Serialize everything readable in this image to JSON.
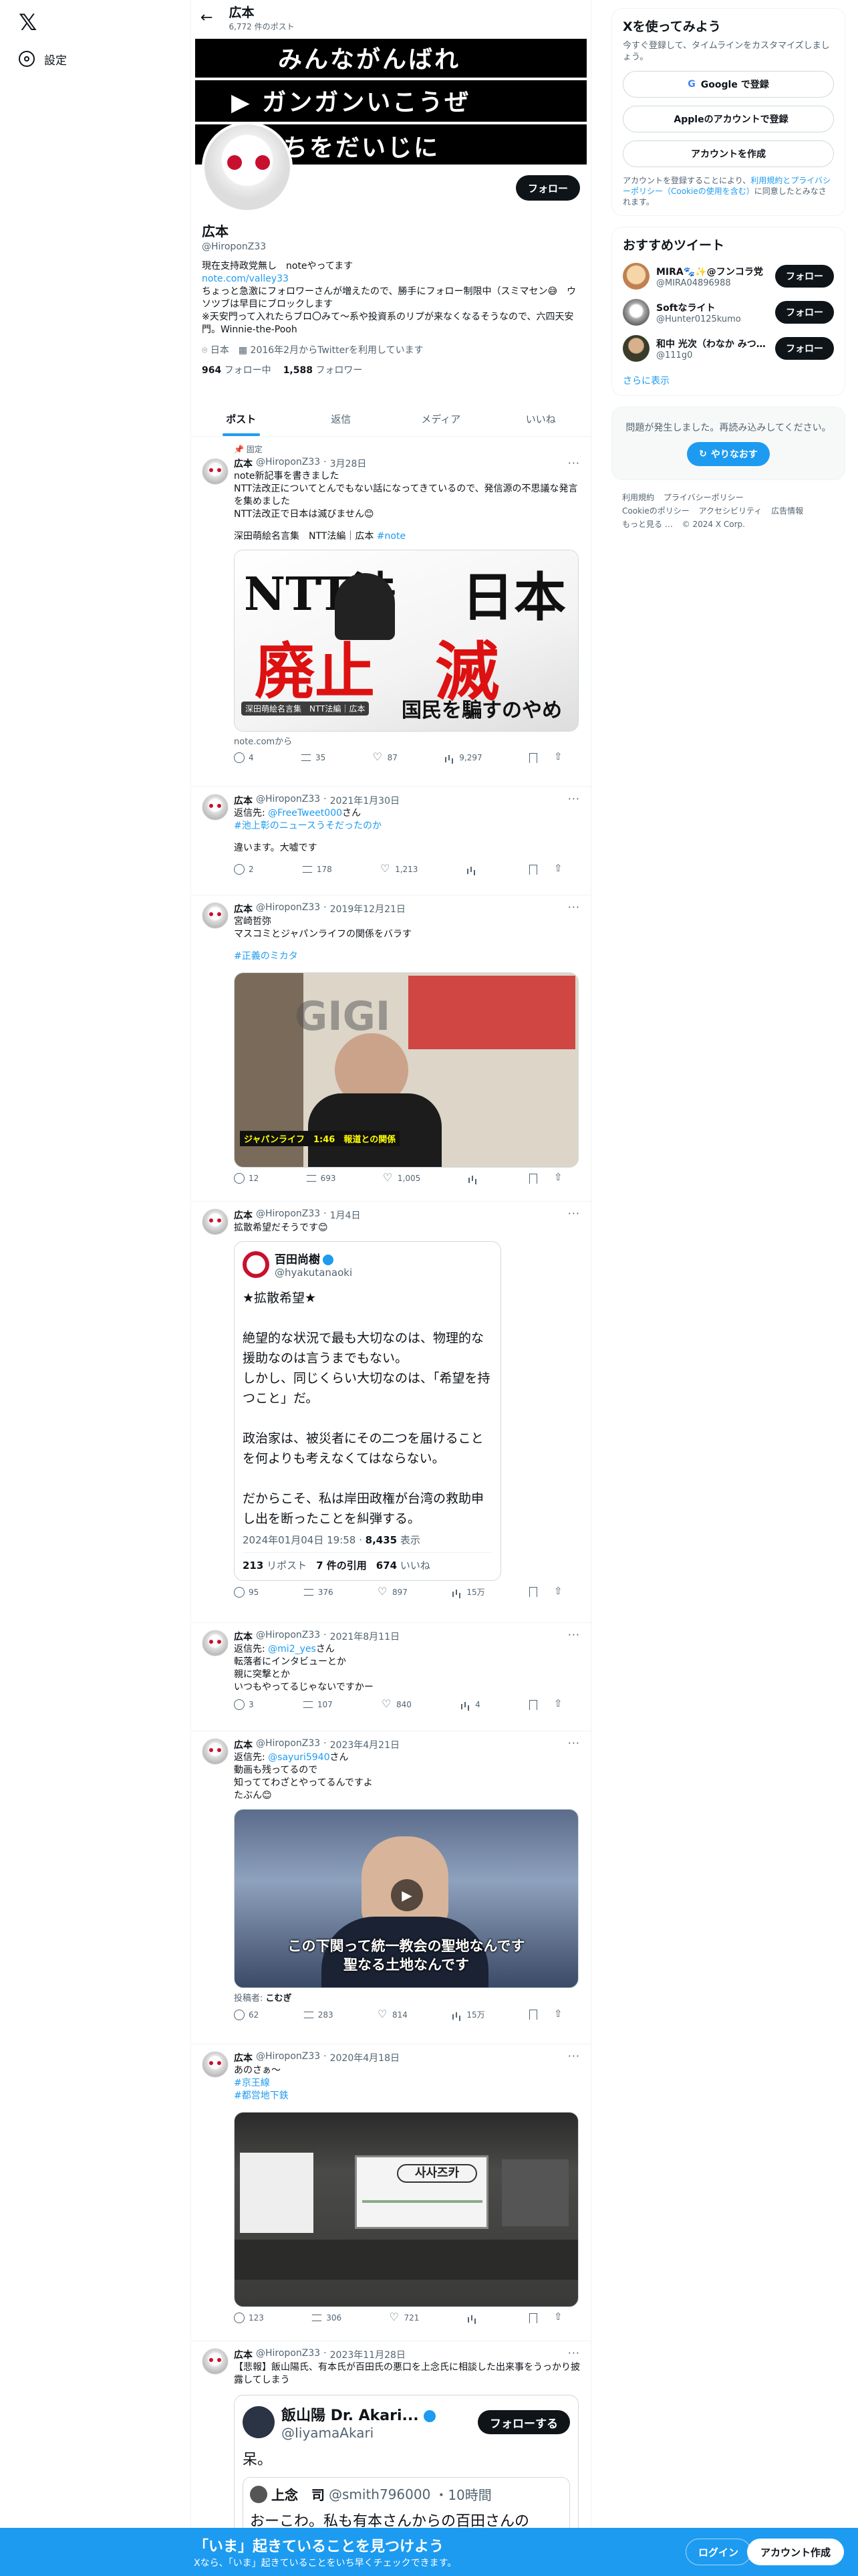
{
  "nav": {
    "settings_label": "設定",
    "logo_glyph": "𝕏"
  },
  "topbar": {
    "name": "広本",
    "post_count": "6,772 件のポスト"
  },
  "banner": {
    "line1": "みんながんばれ",
    "line2": "ガンガンいこうぜ",
    "line3": "いのちをだいじに"
  },
  "profile": {
    "follow_label": "フォロー",
    "name": "広本",
    "handle": "@HiroponZ33",
    "bio_1": "現在支持政党無し　noteやってます",
    "bio_link": "note.com/valley33",
    "bio_2": "ちょっと急激にフォロワーさんが増えたので、勝手にフォロー制限中（スミマセン😅　ウソツブは早目にブロックします\n※天安門って入れたらブロ〇みて〜系や投資系のリプが来なくなるそうなので、六四天安門。Winnie-the-Pooh",
    "location": "日本",
    "joined": "2016年2月からTwitterを利用しています",
    "following_count": "964",
    "following_label": "フォロー中",
    "followers_count": "1,588",
    "followers_label": "フォロワー"
  },
  "tabs": [
    "ポスト",
    "返信",
    "メディア",
    "いいね"
  ],
  "tweets": [
    {
      "pinned": "固定",
      "name": "広本",
      "handle": "@HiroponZ33",
      "date": "3月28日",
      "text": "note新記事を書きました\nNTT法改正についてとんでもない話になってきているので、発信源の不思議な発言を集めました\nNTT法改正で日本は滅びません😊",
      "text2": "深田萌絵名言集　NTT法編｜広本",
      "link": "#note",
      "media_caption": "深田萌絵名言集　NTT法編｜広本",
      "media_texts": {
        "a": "NTT法",
        "b": "廃止",
        "c": "日本",
        "d": "滅",
        "e": "国民を騙すのやめて!"
      },
      "card_source": "note.comから",
      "stats": {
        "reply": "4",
        "retweet": "35",
        "like": "87",
        "views": "9,297"
      }
    },
    {
      "name": "広本",
      "handle": "@HiroponZ33",
      "date": "2021年1月30日",
      "reply_to_label": "返信先:",
      "reply_to": "@FreeTweet000",
      "reply_to_suffix": "さん",
      "hashtag": "#池上彰のニュースうそだったのか",
      "text": "違います。大嘘です",
      "stats": {
        "reply": "2",
        "retweet": "178",
        "like": "1,213",
        "views": ""
      }
    },
    {
      "name": "広本",
      "handle": "@HiroponZ33",
      "date": "2019年12月21日",
      "text": "宮崎哲弥\nマスコミとジャパンライフの関係をバラす",
      "hashtag": "#正義のミカタ",
      "media_caption": "ジャパンライフ　1:46　報道との関係",
      "stats": {
        "reply": "12",
        "retweet": "693",
        "like": "1,005",
        "views": ""
      }
    },
    {
      "name": "広本",
      "handle": "@HiroponZ33",
      "date": "1月4日",
      "text": "拡散希望だそうです😊",
      "quote": {
        "name": "百田尚樹",
        "handle": "@hyakutanaoki",
        "text": "★拡散希望★\n\n絶望的な状況で最も大切なのは、物理的な援助なのは言うまでもない。\nしかし、同じくらい大切なのは、「希望を持つこと」だ。\n\n政治家は、被災者にその二つを届けることを何よりも考えなくてはならない。\n\nだからこそ、私は岸田政権が台湾の救助申し出を断ったことを糾弾する。",
        "date": "2024年01月04日 19:58",
        "views_count": "8,435",
        "views_label": "表示",
        "reposts": "213",
        "reposts_label": "リポスト",
        "quotes": "7 件の引用",
        "likes": "674",
        "likes_label": "いいね"
      },
      "stats": {
        "reply": "95",
        "retweet": "376",
        "like": "897",
        "views": "15万"
      }
    },
    {
      "name": "広本",
      "handle": "@HiroponZ33",
      "date": "2021年8月11日",
      "reply_to_label": "返信先:",
      "reply_to": "@mi2_yes",
      "reply_to_suffix": "さん",
      "text": "転落者にインタビューとか\n親に突撃とか\nいつもやってるじゃないですかー",
      "stats": {
        "reply": "3",
        "retweet": "107",
        "like": "840",
        "views": "4"
      }
    },
    {
      "name": "広本",
      "handle": "@HiroponZ33",
      "date": "2023年4月21日",
      "reply_to_label": "返信先:",
      "reply_to": "@sayuri5940",
      "reply_to_suffix": "さん",
      "text": "動画も残ってるので\n知っててわざとやってるんですよ\nたぶん😊",
      "media_caption": "この下関って統一教会の聖地なんです\n聖なる土地なんです",
      "poster_label": "投稿者:",
      "poster": "こむぎ",
      "stats": {
        "reply": "62",
        "retweet": "283",
        "like": "814",
        "views": "15万"
      }
    },
    {
      "name": "広本",
      "handle": "@HiroponZ33",
      "date": "2020年4月18日",
      "text": "あのさぁ〜",
      "hashtag": "#京王線",
      "hashtag2": "#都営地下鉄",
      "media_caption": "사사즈카",
      "stats": {
        "reply": "123",
        "retweet": "306",
        "like": "721",
        "views": ""
      }
    },
    {
      "name": "広本",
      "handle": "@HiroponZ33",
      "date": "2023年11月28日",
      "text": "【悲報】飯山陽氏、有本氏が百田氏の悪口を上念氏に相談した出来事をうっかり披露してしまう",
      "quote_name": "飯山陽 Dr. Akari...",
      "quote_handle": "@IiyamaAkari",
      "quote_follow": "フォローする",
      "quote_text": "呆。",
      "inner_name": "上念　司",
      "inner_handle": "@smith796000",
      "inner_time": "・10時間",
      "inner_text": "おーこわ。私も有本さんからの百田さんの"
    }
  ],
  "right": {
    "signup_title": "Xを使ってみよう",
    "signup_sub": "今すぐ登録して、タイムラインをカスタマイズしましょう。",
    "google_label": "Google で登録",
    "apple_label": "Appleのアカウントで登録",
    "create_label": "アカウントを作成",
    "legal": "アカウントを登録することにより、",
    "legal_link": "利用規約とプライバシーポリシー（Cookieの使用を含む）",
    "legal_end": "に同意したとみなされます。",
    "suggest_title": "おすすめツイート",
    "suggestions": [
      {
        "name": "MIRA🐾✨@フンコラ党",
        "handle": "@MIRA04896988",
        "follow": "フォロー"
      },
      {
        "name": "Softなライト",
        "handle": "@Hunter0125kumo",
        "follow": "フォロー"
      },
      {
        "name": "和中 光次（わなか みつ…",
        "handle": "@111g0",
        "follow": "フォロー"
      }
    ],
    "show_more": "さらに表示",
    "error_text": "問題が発生しました。再読み込みしてください。",
    "retry_label": "やりなおす",
    "footer": [
      "利用規約",
      "プライバシーポリシー",
      "Cookieのポリシー",
      "アクセシビリティ",
      "広告情報",
      "もっと見る …",
      "© 2024 X Corp."
    ]
  },
  "bottombar": {
    "title": "「いま」起きていることを見つけよう",
    "sub": "Xなら、「いま」起きていることをいち早くチェックできます。",
    "login": "ログイン",
    "signup": "アカウント作成"
  },
  "colors": {
    "accent": "#1d9bf0",
    "text": "#0f1419",
    "muted": "#536471"
  }
}
